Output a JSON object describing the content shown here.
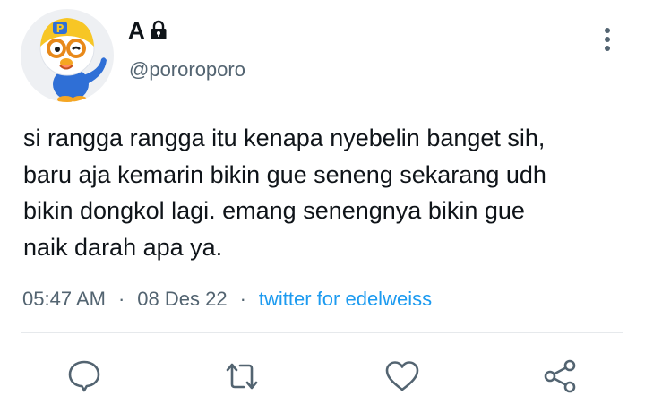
{
  "user": {
    "display_name": "A",
    "handle": "@pororoporo",
    "avatar_icon": "pororo-penguin-avatar",
    "protected_icon": "lock-icon"
  },
  "tweet": {
    "lines": [
      "si rangga rangga itu kenapa nyebelin banget sih,",
      "baru aja kemarin bikin gue seneng sekarang udh",
      "bikin dongkol lagi. emang senengnya bikin gue",
      "naik darah apa ya."
    ]
  },
  "meta": {
    "time": "05:47 AM",
    "separator": "·",
    "date": "08 Des 22",
    "source": "twitter for edelweiss"
  },
  "actions": [
    "reply-icon",
    "retweet-icon",
    "like-icon",
    "share-icon"
  ],
  "colors": {
    "text": "#0f1419",
    "secondary": "#536471",
    "accent": "#1d9bf0",
    "icon": "#536471"
  }
}
